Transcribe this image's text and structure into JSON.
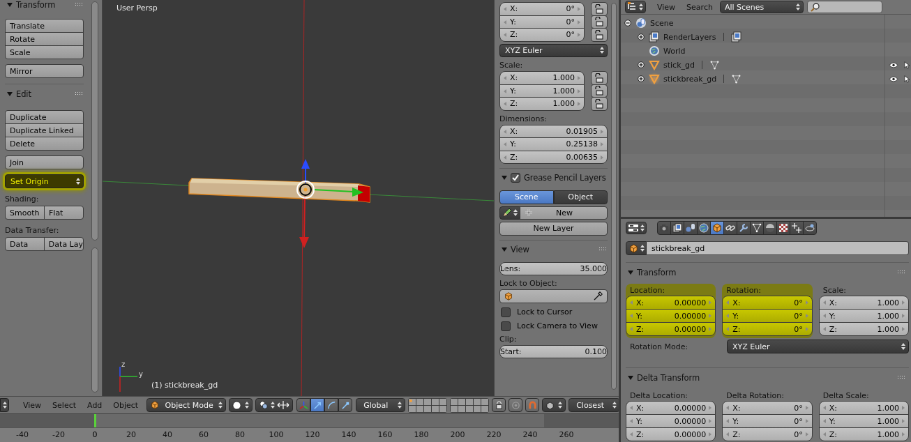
{
  "toolbar": {
    "items": [
      {
        "kind": "header",
        "title": "Transform"
      },
      {
        "kind": "stack",
        "buttons": [
          "Translate",
          "Rotate",
          "Scale"
        ]
      },
      {
        "kind": "stack",
        "buttons": [
          "Mirror"
        ]
      },
      {
        "kind": "header",
        "title": "Edit"
      },
      {
        "kind": "stack",
        "buttons": [
          "Duplicate",
          "Duplicate Linked",
          "Delete"
        ]
      },
      {
        "kind": "stack",
        "buttons": [
          "Join"
        ]
      },
      {
        "kind": "dropdown",
        "value": "Set Origin",
        "highlighted": true
      },
      {
        "kind": "label",
        "text": "Shading:"
      },
      {
        "kind": "row",
        "buttons": [
          "Smooth",
          "Flat"
        ]
      },
      {
        "kind": "label",
        "text": "Data Transfer:"
      },
      {
        "kind": "row",
        "buttons": [
          "Data",
          "Data Lay"
        ]
      }
    ]
  },
  "viewport": {
    "view_name": "User Persp",
    "object_info": "(1) stickbreak_gd",
    "axis_labels": [
      "z",
      "y"
    ]
  },
  "n_panel": {
    "items": [
      {
        "kind": "vector",
        "fields": [
          {
            "axis": "X:",
            "value": "0°",
            "locked": false
          },
          {
            "axis": "Y:",
            "value": "0°",
            "locked": false
          },
          {
            "axis": "Z:",
            "value": "0°",
            "locked": false
          }
        ]
      },
      {
        "kind": "dropdown",
        "value": "XYZ Euler",
        "highlighted": false
      },
      {
        "kind": "label",
        "text": "Scale:"
      },
      {
        "kind": "vector",
        "fields": [
          {
            "axis": "X:",
            "value": "1.000",
            "locked": false
          },
          {
            "axis": "Y:",
            "value": "1.000",
            "locked": false
          },
          {
            "axis": "Z:",
            "value": "1.000",
            "locked": false
          }
        ]
      },
      {
        "kind": "label",
        "text": "Dimensions:"
      },
      {
        "kind": "vector",
        "fields": [
          {
            "axis": "X:",
            "value": "0.01905"
          },
          {
            "axis": "Y:",
            "value": "0.25138"
          },
          {
            "axis": "Z:",
            "value": "0.00635"
          }
        ]
      },
      {
        "kind": "header",
        "title": "Grease Pencil Layers",
        "checked": true
      },
      {
        "kind": "tabs",
        "tabs": [
          {
            "label": "Scene",
            "selected": true
          },
          {
            "label": "Object",
            "selected": false
          }
        ]
      },
      {
        "kind": "new",
        "label": "New"
      },
      {
        "kind": "button",
        "label": "New Layer"
      },
      {
        "kind": "header",
        "title": "View"
      },
      {
        "kind": "field",
        "label": "Lens:",
        "value": "35.000"
      },
      {
        "kind": "label",
        "text": "Lock to Object:"
      },
      {
        "kind": "object_field"
      },
      {
        "kind": "checkbox",
        "label": "Lock to Cursor",
        "checked": false
      },
      {
        "kind": "checkbox",
        "label": "Lock Camera to View",
        "checked": false
      },
      {
        "kind": "label",
        "text": "Clip:"
      },
      {
        "kind": "field",
        "label": "Start:",
        "value": "0.100"
      }
    ]
  },
  "view_header": {
    "menus": [
      "View",
      "Select",
      "Add",
      "Object"
    ],
    "mode": "Object Mode",
    "manipulators": [
      {
        "kind": "translate",
        "selected": true
      },
      {
        "kind": "rotate",
        "selected": false
      },
      {
        "kind": "scale",
        "selected": false
      }
    ],
    "orientation": "Global",
    "snap_element": "Closest"
  },
  "timeline": {
    "frames": [
      {
        "label": "-40",
        "current": false
      },
      {
        "label": "-20",
        "current": false
      },
      {
        "label": "0",
        "current": true
      },
      {
        "label": "20",
        "current": false
      },
      {
        "label": "40",
        "current": false
      },
      {
        "label": "60",
        "current": false
      },
      {
        "label": "80",
        "current": false
      },
      {
        "label": "100",
        "current": false
      },
      {
        "label": "120",
        "current": false
      },
      {
        "label": "140",
        "current": false
      },
      {
        "label": "160",
        "current": false
      },
      {
        "label": "180",
        "current": false
      },
      {
        "label": "200",
        "current": false
      },
      {
        "label": "220",
        "current": false
      },
      {
        "label": "240",
        "current": false
      },
      {
        "label": "260",
        "current": false
      }
    ]
  },
  "outliner": {
    "menus": [
      "View",
      "Search"
    ],
    "display_mode": "All Scenes",
    "tree": [
      {
        "label": "Scene",
        "kind": "scene",
        "expanded": true,
        "selected": false,
        "children": [
          {
            "label": "RenderLayers",
            "kind": "render_layers",
            "expanded": false,
            "selected": false
          },
          {
            "label": "World",
            "kind": "world",
            "selected": false
          },
          {
            "label": "stick_gd",
            "kind": "mesh_object",
            "expanded": false,
            "selected": false
          },
          {
            "label": "stickbreak_gd",
            "kind": "mesh_object",
            "expanded": false,
            "selected": true
          }
        ]
      }
    ]
  },
  "properties": {
    "tabs": [
      {
        "kind": "render",
        "selected": false
      },
      {
        "kind": "layers",
        "selected": false
      },
      {
        "kind": "scene",
        "selected": false
      },
      {
        "kind": "world",
        "selected": false
      },
      {
        "kind": "object",
        "selected": true
      },
      {
        "kind": "constraints",
        "selected": false
      },
      {
        "kind": "modifiers",
        "selected": false
      },
      {
        "kind": "data",
        "selected": false
      },
      {
        "kind": "material",
        "selected": false
      },
      {
        "kind": "texture",
        "selected": false
      },
      {
        "kind": "particles",
        "selected": false
      },
      {
        "kind": "physics",
        "selected": false
      }
    ],
    "object_name": "stickbreak_gd",
    "panels": [
      {
        "title": "Transform",
        "groups": [
          {
            "label": "Location:",
            "highlighted": true,
            "fields": [
              {
                "axis": "X:",
                "value": "0.00000"
              },
              {
                "axis": "Y:",
                "value": "0.00000"
              },
              {
                "axis": "Z:",
                "value": "0.00000"
              }
            ]
          },
          {
            "label": "Rotation:",
            "highlighted": true,
            "fields": [
              {
                "axis": "X:",
                "value": "0°"
              },
              {
                "axis": "Y:",
                "value": "0°"
              },
              {
                "axis": "Z:",
                "value": "0°"
              }
            ]
          },
          {
            "label": "Scale:",
            "highlighted": false,
            "fields": [
              {
                "axis": "X:",
                "value": "1.000"
              },
              {
                "axis": "Y:",
                "value": "1.000"
              },
              {
                "axis": "Z:",
                "value": "1.000"
              }
            ]
          }
        ],
        "rotation_mode": {
          "label": "Rotation Mode:",
          "value": "XYZ Euler"
        }
      },
      {
        "title": "Delta Transform",
        "groups": [
          {
            "label": "Delta Location:",
            "highlighted": false,
            "fields": [
              {
                "axis": "X:",
                "value": "0.00000"
              },
              {
                "axis": "Y:",
                "value": "0.00000"
              },
              {
                "axis": "Z:",
                "value": "0.00000"
              }
            ]
          },
          {
            "label": "Delta Rotation:",
            "highlighted": false,
            "fields": [
              {
                "axis": "X:",
                "value": "0°"
              },
              {
                "axis": "Y:",
                "value": "0°"
              },
              {
                "axis": "Z:",
                "value": "0°"
              }
            ]
          },
          {
            "label": "Delta Scale:",
            "highlighted": false,
            "fields": [
              {
                "axis": "X:",
                "value": "1.000"
              },
              {
                "axis": "Y:",
                "value": "1.000"
              },
              {
                "axis": "Z:",
                "value": "1.000"
              }
            ]
          }
        ]
      }
    ]
  }
}
